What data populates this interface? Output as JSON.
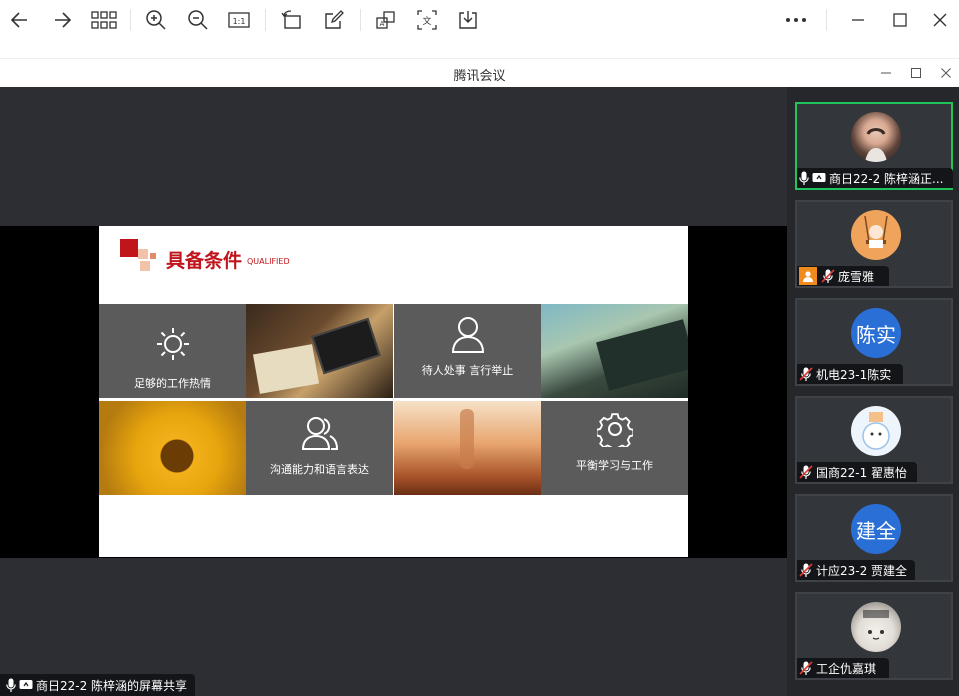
{
  "toolbar": {
    "icons": [
      "back-icon",
      "forward-icon",
      "grid-icon",
      "zoom-in-icon",
      "zoom-out-icon",
      "actual-size-icon",
      "rotate-icon",
      "edit-icon",
      "ocr-icon",
      "translate-icon",
      "download-icon",
      "more-icon",
      "minimize-icon",
      "maximize-icon",
      "close-icon"
    ]
  },
  "window": {
    "title": "腾讯会议"
  },
  "slide": {
    "title": "具备条件",
    "subtitle": "QUALIFIED",
    "tiles": [
      {
        "label": "足够的工作热情",
        "icon": "sun-icon"
      },
      {
        "label": "待人处事  言行举止",
        "icon": "user-icon"
      },
      {
        "label": "沟通能力和语言表达",
        "icon": "users-icon"
      },
      {
        "label": "平衡学习与工作",
        "icon": "gear-icon"
      }
    ],
    "photos": [
      "desk-photo",
      "boat-photo",
      "flower-photo",
      "road-photo"
    ]
  },
  "participants": [
    {
      "name": "商日22-2 陈梓涵正...",
      "avatar_text": "",
      "avatar_kind": "photo-girl",
      "mic": "on",
      "screen_share": true,
      "host": false,
      "active": true
    },
    {
      "name": "庞雪雅",
      "avatar_text": "",
      "avatar_kind": "cartoon-swing",
      "mic": "muted",
      "screen_share": false,
      "host": true,
      "active": false
    },
    {
      "name": "机电23-1陈实",
      "avatar_text": "陈实",
      "avatar_kind": "text",
      "mic": "muted",
      "screen_share": false,
      "host": false,
      "active": false
    },
    {
      "name": "国商22-1 翟惠怡",
      "avatar_text": "",
      "avatar_kind": "cartoon-bear",
      "mic": "muted",
      "screen_share": false,
      "host": false,
      "active": false
    },
    {
      "name": "计应23-2 贾建全",
      "avatar_text": "建全",
      "avatar_kind": "text",
      "mic": "muted",
      "screen_share": false,
      "host": false,
      "active": false
    },
    {
      "name": "工企仇嘉琪",
      "avatar_text": "",
      "avatar_kind": "photo-cat",
      "mic": "muted",
      "screen_share": false,
      "host": false,
      "active": false
    }
  ],
  "share_status": {
    "label": "商日22-2 陈梓涵的屏幕共享"
  },
  "colors": {
    "accent_active": "#20c45a",
    "avatar_blue": "#2a6fd6",
    "slide_red": "#c0151b"
  }
}
